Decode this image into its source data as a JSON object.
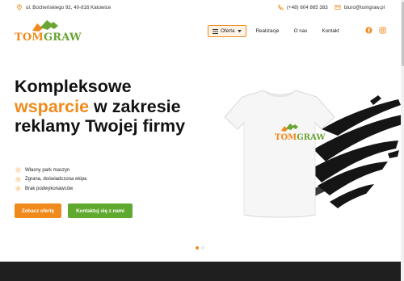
{
  "topbar": {
    "address": "ul. Bocheńskiego 92, 40-816 Katowice",
    "phone": "(+48) 604 865 383",
    "email": "biuro@tomgraw.pl"
  },
  "logo": {
    "part1": "TOM",
    "part2": "GRAW"
  },
  "nav": {
    "offer_label": "Oferta",
    "items": [
      "Realizacje",
      "O nas",
      "Kontakt"
    ]
  },
  "hero": {
    "title_line1": "Kompleksowe",
    "title_accent": "wsparcie",
    "title_rest": " w zakresie reklamy Twojej firmy",
    "features": [
      "Własny park maszyn",
      "Zgrana, doświadczona ekipa",
      "Brak podwykonawców"
    ],
    "btn_offer": "Zobacz ofertę",
    "btn_contact": "Kontaktuj się z nami"
  },
  "tshirt_logo": {
    "part1": "TOM",
    "part2": "GRAW"
  },
  "icons": {
    "location": "location-pin-icon",
    "phone": "phone-icon",
    "email": "mail-icon",
    "facebook": "facebook-icon",
    "instagram": "instagram-icon"
  },
  "colors": {
    "orange": "#f08a1c",
    "green": "#5faa2e",
    "dark": "#1f1f1f"
  },
  "slider": {
    "slides": 2,
    "active": 1
  }
}
